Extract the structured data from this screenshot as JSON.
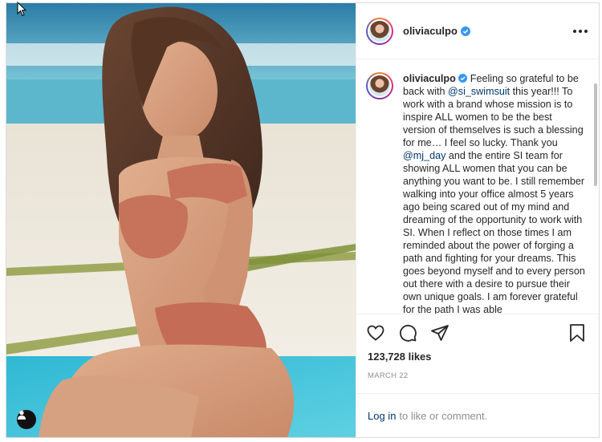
{
  "post": {
    "username": "oliviaculpo",
    "caption_pre_mention_1": "Feeling so grateful to be back with ",
    "mention_1": "@si_swimsuit",
    "caption_mid": " this year!!! To work with a brand whose mission is to inspire ALL women to be the best version of themselves is such a blessing for me… I feel so lucky. Thank you ",
    "mention_2": "@mj_day",
    "caption_post": " and the entire SI team for showing ALL women that you can be anything you want to be. I still remember walking into your office almost 5 years ago being scared out of my mind and dreaming of the opportunity to work with SI. When I reflect on those times I am reminded about the power of forging a path and fighting for your dreams. This goes beyond myself and to every person out there with a desire to pursue their own unique goals. I am forever grateful for the path I was able",
    "likes": "123,728 likes",
    "date": "MARCH 22",
    "login_link": "Log in",
    "login_rest": "to like or comment."
  },
  "icons": {
    "more": "more-options-icon",
    "verified": "verified-badge-icon",
    "like": "heart-icon",
    "comment": "comment-icon",
    "share": "share-icon",
    "save": "bookmark-icon",
    "user_tag": "user-tag-icon",
    "cursor": "mouse-cursor-icon"
  },
  "colors": {
    "link": "#00376b",
    "verified": "#3897f0",
    "muted": "#8e8e8e",
    "border": "#dbdbdb"
  }
}
